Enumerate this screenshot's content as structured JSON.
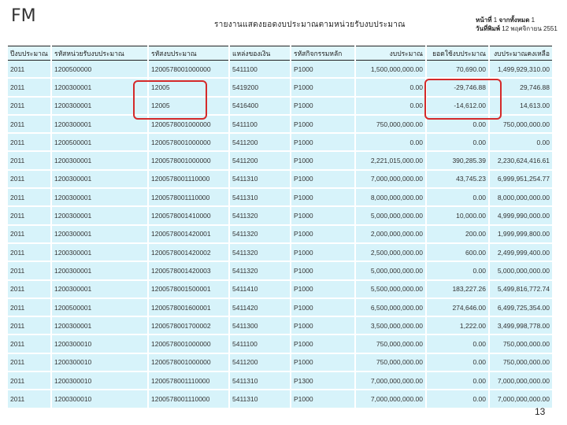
{
  "header": {
    "app_label": "FM",
    "report_title": "รายงานแสดงยอดงบประมาณตามหน่วยรับงบประมาณ",
    "page_label": "หน้าที่",
    "page_value": "1",
    "total_label": "จากทั้งหมด",
    "total_value": "1",
    "date_label": "วันที่พิมพ์",
    "date_value": "12 พฤศจิกายน 2551"
  },
  "table": {
    "columns": [
      "ปีงบประมาณ",
      "รหัสหน่วยรับงบประมาณ",
      "รหัสงบประมาณ",
      "แหล่งของเงิน",
      "รหัสกิจกรรมหลัก",
      "งบประมาณ",
      "ยอดใช้งบประมาณ",
      "งบประมาณคงเหลือ"
    ],
    "rows": [
      [
        "2011",
        "1200500000",
        "1200578001000000",
        "5411100",
        "P1000",
        "1,500,000,000.00",
        "70,690.00",
        "1,499,929,310.00"
      ],
      [
        "2011",
        "1200300001",
        "12005",
        "5419200",
        "P1000",
        "0.00",
        "-29,746.88",
        "29,746.88"
      ],
      [
        "2011",
        "1200300001",
        "12005",
        "5416400",
        "P1000",
        "0.00",
        "-14,612.00",
        "14,613.00"
      ],
      [
        "2011",
        "1200300001",
        "1200578001000000",
        "5411100",
        "P1000",
        "750,000,000.00",
        "0.00",
        "750,000,000.00"
      ],
      [
        "2011",
        "1200500001",
        "1200578001000000",
        "5411200",
        "P1000",
        "0.00",
        "0.00",
        "0.00"
      ],
      [
        "2011",
        "1200300001",
        "1200578001000000",
        "5411200",
        "P1000",
        "2,221,015,000.00",
        "390,285.39",
        "2,230,624,416.61"
      ],
      [
        "2011",
        "1200300001",
        "1200578001110000",
        "5411310",
        "P1000",
        "7,000,000,000.00",
        "43,745.23",
        "6,999,951,254.77"
      ],
      [
        "2011",
        "1200300001",
        "1200578001110000",
        "5411310",
        "P1000",
        "8,000,000,000.00",
        "0.00",
        "8,000,000,000.00"
      ],
      [
        "2011",
        "1200300001",
        "1200578001410000",
        "5411320",
        "P1000",
        "5,000,000,000.00",
        "10,000.00",
        "4,999,990,000.00"
      ],
      [
        "2011",
        "1200300001",
        "1200578001420001",
        "5411320",
        "P1000",
        "2,000,000,000.00",
        "200.00",
        "1,999,999,800.00"
      ],
      [
        "2011",
        "1200300001",
        "1200578001420002",
        "5411320",
        "P1000",
        "2,500,000,000.00",
        "600.00",
        "2,499,999,400.00"
      ],
      [
        "2011",
        "1200300001",
        "1200578001420003",
        "5411320",
        "P1000",
        "5,000,000,000.00",
        "0.00",
        "5,000,000,000.00"
      ],
      [
        "2011",
        "1200300001",
        "1200578001500001",
        "5411410",
        "P1000",
        "5,500,000,000.00",
        "183,227.26",
        "5,499,816,772.74"
      ],
      [
        "2011",
        "1200500001",
        "1200578001600001",
        "5411420",
        "P1000",
        "6,500,000,000.00",
        "274,646.00",
        "6,499,725,354.00"
      ],
      [
        "2011",
        "1200300001",
        "1200578001700002",
        "5411300",
        "P1000",
        "3,500,000,000.00",
        "1,222.00",
        "3,499,998,778.00"
      ],
      [
        "2011",
        "1200300010",
        "1200578001000000",
        "5411100",
        "P1000",
        "750,000,000.00",
        "0.00",
        "750,000,000.00"
      ],
      [
        "2011",
        "1200300010",
        "1200578001000000",
        "5411200",
        "P1000",
        "750,000,000.00",
        "0.00",
        "750,000,000.00"
      ],
      [
        "2011",
        "1200300010",
        "1200578001110000",
        "5411310",
        "P1300",
        "7,000,000,000.00",
        "0.00",
        "7,000,000,000.00"
      ],
      [
        "2011",
        "1200300010",
        "1200578001110000",
        "5411310",
        "P1000",
        "7,000,000,000.00",
        "0.00",
        "7,000,000,000.00"
      ]
    ]
  },
  "footer": {
    "page_number": "13"
  },
  "colors": {
    "highlight": "#d42a2a",
    "row_background": "#d7f3fa"
  }
}
